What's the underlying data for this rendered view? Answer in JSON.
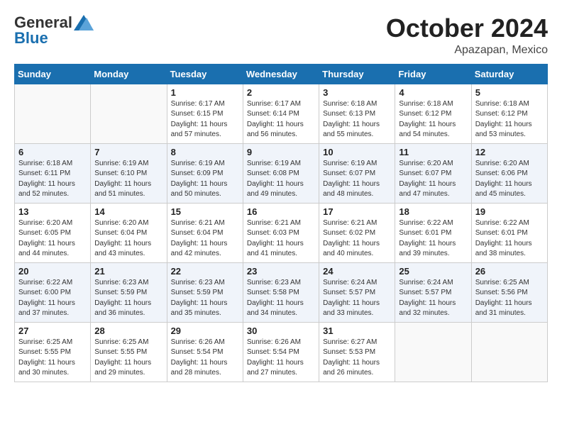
{
  "header": {
    "logo_line1": "General",
    "logo_line2": "Blue",
    "month": "October 2024",
    "location": "Apazapan, Mexico"
  },
  "weekdays": [
    "Sunday",
    "Monday",
    "Tuesday",
    "Wednesday",
    "Thursday",
    "Friday",
    "Saturday"
  ],
  "weeks": [
    [
      {
        "day": "",
        "info": ""
      },
      {
        "day": "",
        "info": ""
      },
      {
        "day": "1",
        "info": "Sunrise: 6:17 AM\nSunset: 6:15 PM\nDaylight: 11 hours and 57 minutes."
      },
      {
        "day": "2",
        "info": "Sunrise: 6:17 AM\nSunset: 6:14 PM\nDaylight: 11 hours and 56 minutes."
      },
      {
        "day": "3",
        "info": "Sunrise: 6:18 AM\nSunset: 6:13 PM\nDaylight: 11 hours and 55 minutes."
      },
      {
        "day": "4",
        "info": "Sunrise: 6:18 AM\nSunset: 6:12 PM\nDaylight: 11 hours and 54 minutes."
      },
      {
        "day": "5",
        "info": "Sunrise: 6:18 AM\nSunset: 6:12 PM\nDaylight: 11 hours and 53 minutes."
      }
    ],
    [
      {
        "day": "6",
        "info": "Sunrise: 6:18 AM\nSunset: 6:11 PM\nDaylight: 11 hours and 52 minutes."
      },
      {
        "day": "7",
        "info": "Sunrise: 6:19 AM\nSunset: 6:10 PM\nDaylight: 11 hours and 51 minutes."
      },
      {
        "day": "8",
        "info": "Sunrise: 6:19 AM\nSunset: 6:09 PM\nDaylight: 11 hours and 50 minutes."
      },
      {
        "day": "9",
        "info": "Sunrise: 6:19 AM\nSunset: 6:08 PM\nDaylight: 11 hours and 49 minutes."
      },
      {
        "day": "10",
        "info": "Sunrise: 6:19 AM\nSunset: 6:07 PM\nDaylight: 11 hours and 48 minutes."
      },
      {
        "day": "11",
        "info": "Sunrise: 6:20 AM\nSunset: 6:07 PM\nDaylight: 11 hours and 47 minutes."
      },
      {
        "day": "12",
        "info": "Sunrise: 6:20 AM\nSunset: 6:06 PM\nDaylight: 11 hours and 45 minutes."
      }
    ],
    [
      {
        "day": "13",
        "info": "Sunrise: 6:20 AM\nSunset: 6:05 PM\nDaylight: 11 hours and 44 minutes."
      },
      {
        "day": "14",
        "info": "Sunrise: 6:20 AM\nSunset: 6:04 PM\nDaylight: 11 hours and 43 minutes."
      },
      {
        "day": "15",
        "info": "Sunrise: 6:21 AM\nSunset: 6:04 PM\nDaylight: 11 hours and 42 minutes."
      },
      {
        "day": "16",
        "info": "Sunrise: 6:21 AM\nSunset: 6:03 PM\nDaylight: 11 hours and 41 minutes."
      },
      {
        "day": "17",
        "info": "Sunrise: 6:21 AM\nSunset: 6:02 PM\nDaylight: 11 hours and 40 minutes."
      },
      {
        "day": "18",
        "info": "Sunrise: 6:22 AM\nSunset: 6:01 PM\nDaylight: 11 hours and 39 minutes."
      },
      {
        "day": "19",
        "info": "Sunrise: 6:22 AM\nSunset: 6:01 PM\nDaylight: 11 hours and 38 minutes."
      }
    ],
    [
      {
        "day": "20",
        "info": "Sunrise: 6:22 AM\nSunset: 6:00 PM\nDaylight: 11 hours and 37 minutes."
      },
      {
        "day": "21",
        "info": "Sunrise: 6:23 AM\nSunset: 5:59 PM\nDaylight: 11 hours and 36 minutes."
      },
      {
        "day": "22",
        "info": "Sunrise: 6:23 AM\nSunset: 5:59 PM\nDaylight: 11 hours and 35 minutes."
      },
      {
        "day": "23",
        "info": "Sunrise: 6:23 AM\nSunset: 5:58 PM\nDaylight: 11 hours and 34 minutes."
      },
      {
        "day": "24",
        "info": "Sunrise: 6:24 AM\nSunset: 5:57 PM\nDaylight: 11 hours and 33 minutes."
      },
      {
        "day": "25",
        "info": "Sunrise: 6:24 AM\nSunset: 5:57 PM\nDaylight: 11 hours and 32 minutes."
      },
      {
        "day": "26",
        "info": "Sunrise: 6:25 AM\nSunset: 5:56 PM\nDaylight: 11 hours and 31 minutes."
      }
    ],
    [
      {
        "day": "27",
        "info": "Sunrise: 6:25 AM\nSunset: 5:55 PM\nDaylight: 11 hours and 30 minutes."
      },
      {
        "day": "28",
        "info": "Sunrise: 6:25 AM\nSunset: 5:55 PM\nDaylight: 11 hours and 29 minutes."
      },
      {
        "day": "29",
        "info": "Sunrise: 6:26 AM\nSunset: 5:54 PM\nDaylight: 11 hours and 28 minutes."
      },
      {
        "day": "30",
        "info": "Sunrise: 6:26 AM\nSunset: 5:54 PM\nDaylight: 11 hours and 27 minutes."
      },
      {
        "day": "31",
        "info": "Sunrise: 6:27 AM\nSunset: 5:53 PM\nDaylight: 11 hours and 26 minutes."
      },
      {
        "day": "",
        "info": ""
      },
      {
        "day": "",
        "info": ""
      }
    ]
  ]
}
